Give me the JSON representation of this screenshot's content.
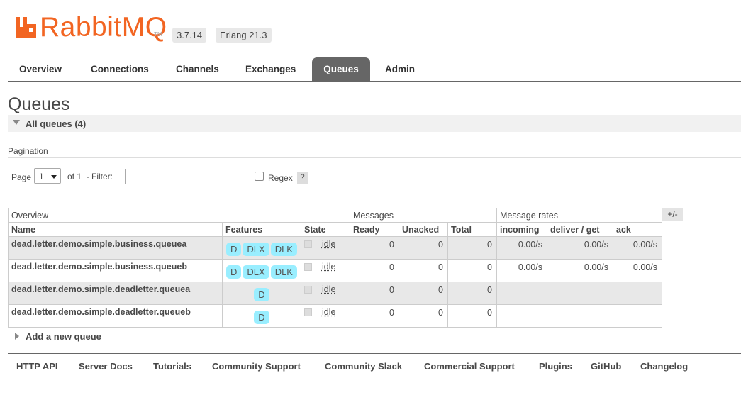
{
  "header": {
    "logo_text": "RabbitMQ",
    "logo_tm": "TM",
    "version": "3.7.14",
    "erlang": "Erlang 21.3",
    "brand_color": "#f26522"
  },
  "tabs": [
    "Overview",
    "Connections",
    "Channels",
    "Exchanges",
    "Queues",
    "Admin"
  ],
  "active_tab": "Queues",
  "page": {
    "title": "Queues",
    "section_title": "All queues (4)",
    "pagination_label": "Pagination",
    "page_word": "Page",
    "page_value": "1",
    "of_label": "of 1  - Filter:",
    "filter_value": "",
    "regex_label": "Regex",
    "regex_help": "?",
    "columns_toggle": "+/-"
  },
  "table": {
    "groups": [
      "Overview",
      "Messages",
      "Message rates"
    ],
    "columns": [
      "Name",
      "Features",
      "State",
      "Ready",
      "Unacked",
      "Total",
      "incoming",
      "deliver / get",
      "ack"
    ],
    "rows": [
      {
        "name": "dead.letter.demo.simple.business.queuea",
        "features": [
          "D",
          "DLX",
          "DLK"
        ],
        "state": "idle",
        "ready": "0",
        "unacked": "0",
        "total": "0",
        "incoming": "0.00/s",
        "deliver": "0.00/s",
        "ack": "0.00/s"
      },
      {
        "name": "dead.letter.demo.simple.business.queueb",
        "features": [
          "D",
          "DLX",
          "DLK"
        ],
        "state": "idle",
        "ready": "0",
        "unacked": "0",
        "total": "0",
        "incoming": "0.00/s",
        "deliver": "0.00/s",
        "ack": "0.00/s"
      },
      {
        "name": "dead.letter.demo.simple.deadletter.queuea",
        "features": [
          "D"
        ],
        "state": "idle",
        "ready": "0",
        "unacked": "0",
        "total": "0",
        "incoming": "",
        "deliver": "",
        "ack": ""
      },
      {
        "name": "dead.letter.demo.simple.deadletter.queueb",
        "features": [
          "D"
        ],
        "state": "idle",
        "ready": "0",
        "unacked": "0",
        "total": "0",
        "incoming": "",
        "deliver": "",
        "ack": ""
      }
    ]
  },
  "add_queue": "Add a new queue",
  "footer": [
    "HTTP API",
    "Server Docs",
    "Tutorials",
    "Community Support",
    "Community Slack",
    "Commercial Support",
    "Plugins",
    "GitHub",
    "Changelog"
  ]
}
